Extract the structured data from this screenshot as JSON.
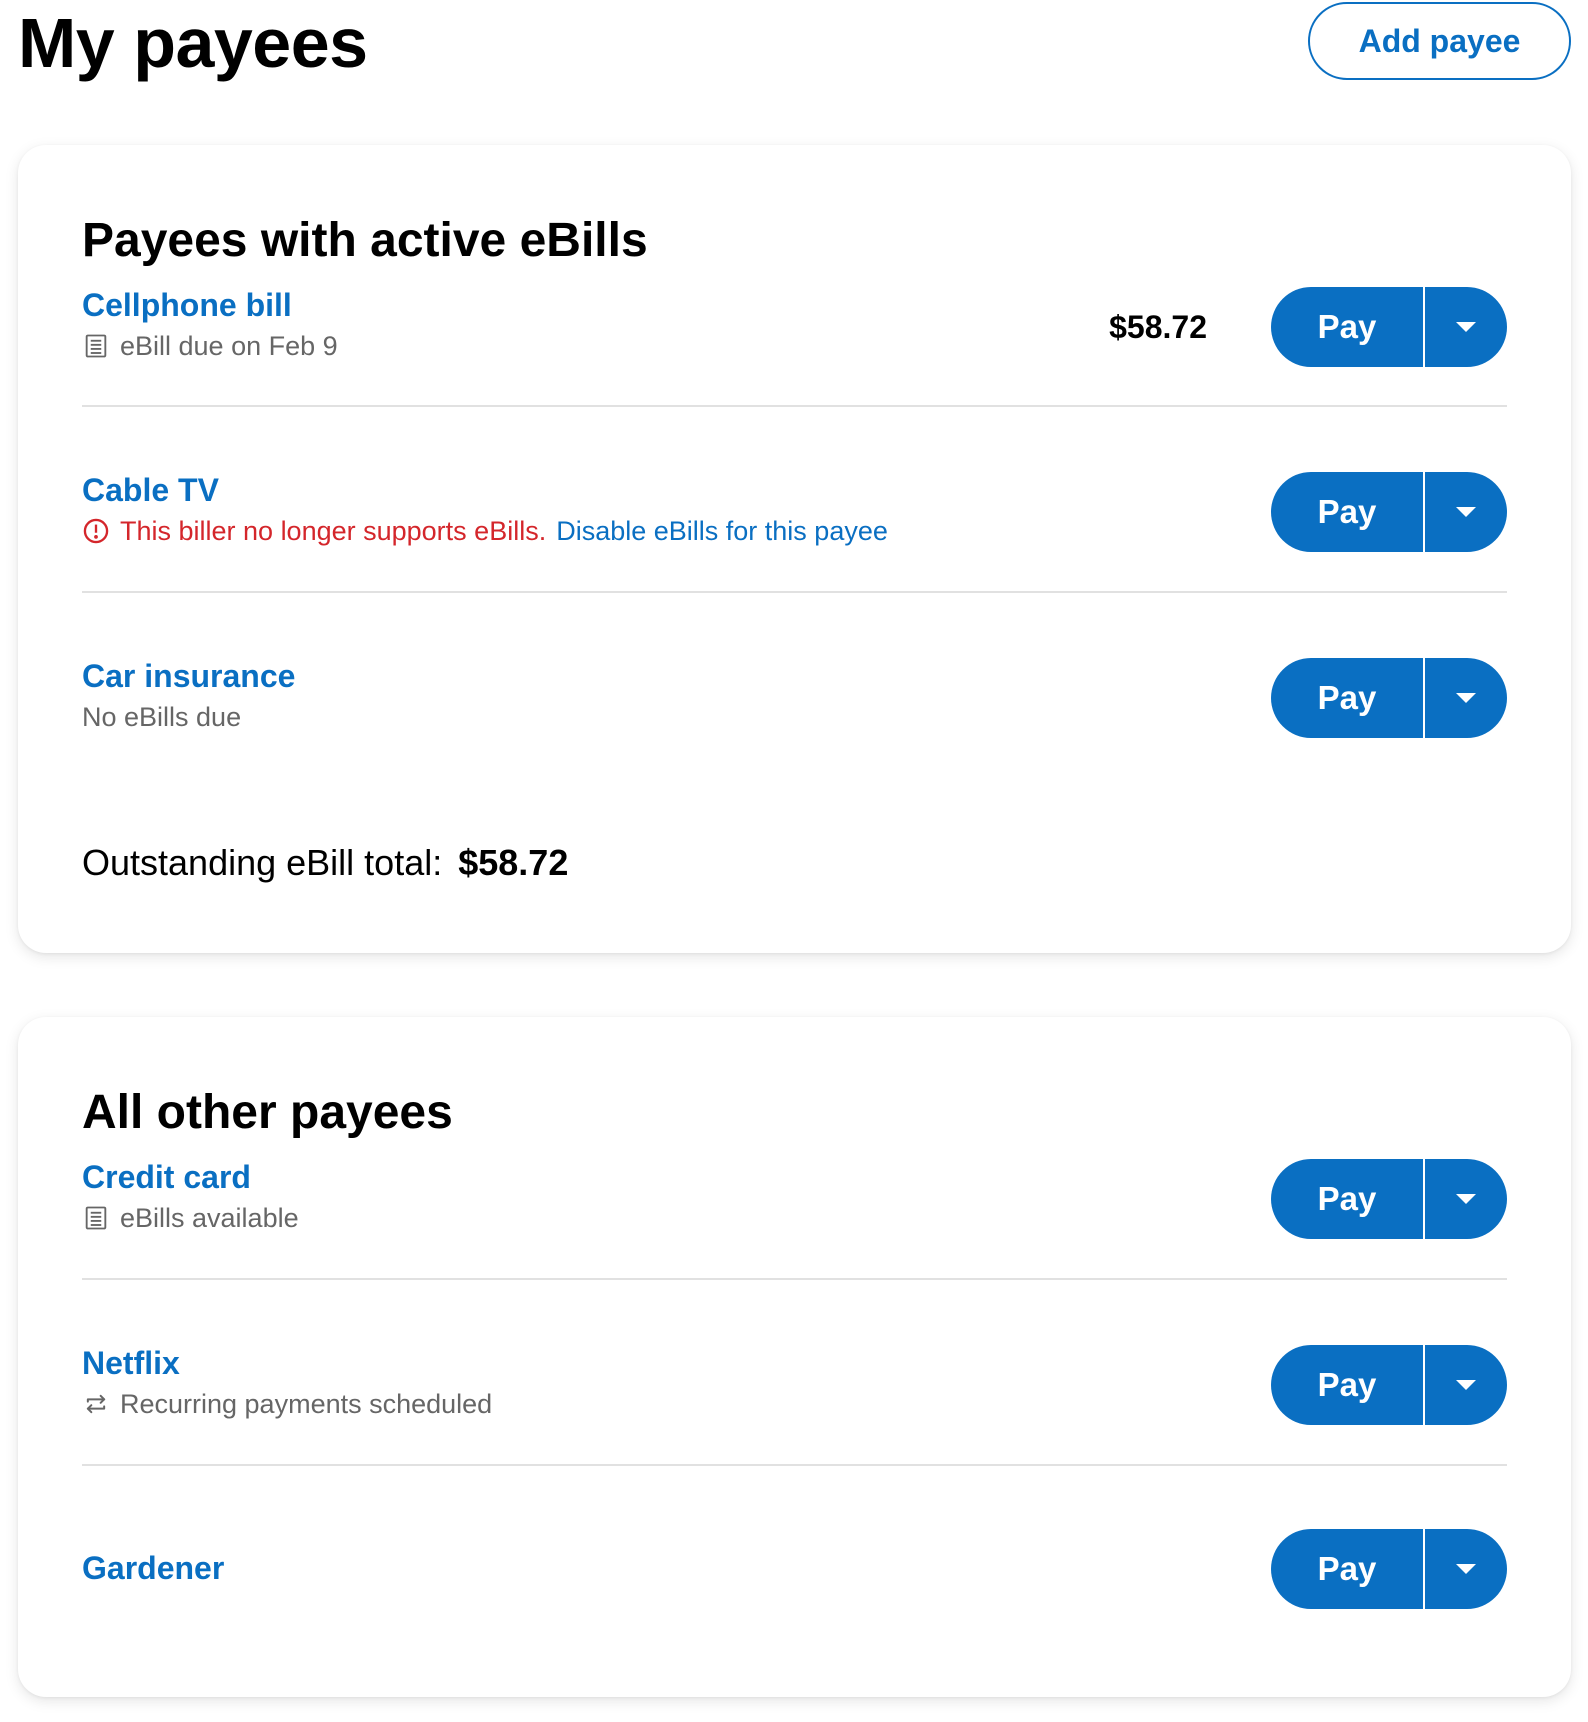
{
  "header": {
    "title": "My payees",
    "add_payee_label": "Add payee"
  },
  "ebills_section": {
    "title": "Payees with active eBills",
    "payees": [
      {
        "name": "Cellphone bill",
        "status_icon": "ebill-icon",
        "status": "eBill due on Feb 9",
        "amount": "$58.72",
        "pay_label": "Pay"
      },
      {
        "name": "Cable TV",
        "status_icon": "alert-circle-icon",
        "status": "This biller no longer supports eBills.",
        "status_link": "Disable eBills for this payee",
        "pay_label": "Pay"
      },
      {
        "name": "Car insurance",
        "status": "No eBills due",
        "pay_label": "Pay"
      }
    ],
    "total_label": "Outstanding eBill total:",
    "total_value": "$58.72"
  },
  "other_section": {
    "title": "All other payees",
    "payees": [
      {
        "name": "Credit card",
        "status_icon": "ebill-icon",
        "status": "eBills available",
        "pay_label": "Pay"
      },
      {
        "name": "Netflix",
        "status_icon": "recurring-icon",
        "status": "Recurring payments scheduled",
        "pay_label": "Pay"
      },
      {
        "name": "Gardener",
        "pay_label": "Pay"
      }
    ]
  },
  "colors": {
    "accent": "#0a6fc2",
    "error": "#d4262b",
    "muted_text": "#666666",
    "divider": "#e1e1e1"
  }
}
